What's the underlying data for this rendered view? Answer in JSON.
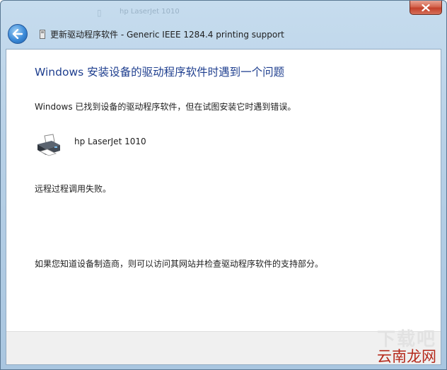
{
  "window": {
    "title": "更新驱动程序软件 - Generic IEEE 1284.4 printing support",
    "background_caption": "hp LaserJet 1010"
  },
  "content": {
    "heading": "Windows 安装设备的驱动程序软件时遇到一个问题",
    "message": "Windows 已找到设备的驱动程序软件，但在试图安装它时遇到错误。",
    "device_name": "hp LaserJet 1010",
    "error_detail": "远程过程调用失败。",
    "manufacturer_hint": "如果您知道设备制造商，则可以访问其网站并检查驱动程序软件的支持部分。"
  },
  "watermark": {
    "top_text": "下载吧",
    "site_text": "云南龙网"
  },
  "icons": {
    "back": "back-arrow-icon",
    "close": "close-icon",
    "wizard": "wizard-icon",
    "printer": "printer-icon"
  },
  "colors": {
    "heading": "#1f3f8f",
    "close_button": "#c3402a",
    "frame": "#b7d0e6",
    "watermark_site": "#b52a1c"
  }
}
